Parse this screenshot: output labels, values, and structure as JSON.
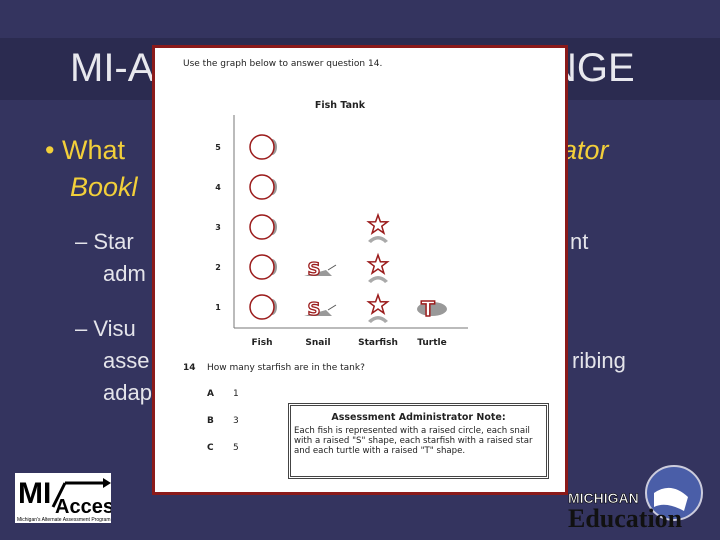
{
  "slide": {
    "title_left": "MI-A",
    "title_right": "NGE",
    "bullet1_left": "• What",
    "bullet1_right": "ator",
    "bullet1_line2": "Bookl",
    "sub1_left": "– Star",
    "sub1_right": "nt",
    "sub1_line2": "adm",
    "sub2_left": "– Visu",
    "sub2_line2": "asse",
    "sub2_line2_right": "ribing",
    "sub2_line3": "adap"
  },
  "colors": {
    "background": "#34345f",
    "title_band": "#2b2b50",
    "bullet_text": "#f2cf3a",
    "overlay_border": "#8b1a1a",
    "icon_red": "#9b1b1b"
  },
  "test_page": {
    "instruction": "Use the graph below to answer question 14.",
    "question_number": "14",
    "question": "How many starfish are in the tank?",
    "options": [
      {
        "letter": "A",
        "value": "1"
      },
      {
        "letter": "B",
        "value": "3"
      },
      {
        "letter": "C",
        "value": "5"
      }
    ],
    "note_title": "Assessment Administrator Note:",
    "note_text": "Each fish is represented with a raised circle, each snail with a raised \"S\" shape, each starfish with a raised star and each turtle with a raised \"T\" shape."
  },
  "chart_data": {
    "type": "bar",
    "title": "Fish Tank",
    "categories": [
      "Fish",
      "Snail",
      "Starfish",
      "Turtle"
    ],
    "values": [
      5,
      2,
      3,
      1
    ],
    "y_ticks": [
      "1",
      "2",
      "3",
      "4",
      "5"
    ],
    "ylim": [
      0,
      5
    ],
    "icons": [
      "circle-fish",
      "s-snail",
      "star-starfish",
      "t-turtle"
    ]
  },
  "logos": {
    "left": "MI Access — Michigan's Alternate Assessment Program",
    "right": "Michigan Department of Education"
  }
}
